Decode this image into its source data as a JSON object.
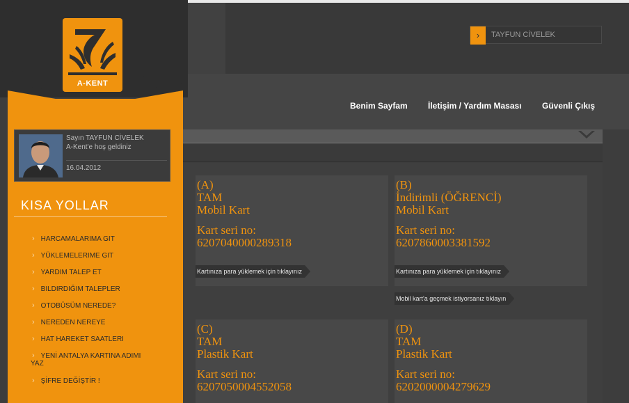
{
  "header": {
    "logo_text": "A-KENT",
    "user_box": {
      "name": "TAYFUN CİVELEK",
      "arrow_icon": "chevron-right-icon"
    }
  },
  "nav": [
    {
      "label": "Benim Sayfam"
    },
    {
      "label": "İletişim / Yardım Masası"
    },
    {
      "label": "Güvenli Çıkış"
    }
  ],
  "profile": {
    "greeting_line1": "Sayın TAYFUN CİVELEK",
    "greeting_line2": "A-Kent'e hoş geldiniz",
    "date": "16.04.2012"
  },
  "shortcuts": {
    "title": "KISA YOLLAR",
    "items": [
      {
        "label": "HARCAMALARIMA GIT"
      },
      {
        "label": "YÜKLEMELERIME GIT"
      },
      {
        "label": "YARDIM TALEP ET"
      },
      {
        "label": "BILDIRDIĞIM TALEPLER"
      },
      {
        "label": "OTOBÜSÜM NEREDE?"
      },
      {
        "label": "NEREDEN NEREYE"
      },
      {
        "label": "HAT HAREKET SAATLERI"
      },
      {
        "label": "YENİ ANTALYA KARTINA ADIMI"
      },
      {
        "label": "YAZ"
      },
      {
        "label": "ŞİFRE DEĞİŞTİR !"
      }
    ]
  },
  "cards": [
    {
      "letter": "(A)",
      "type": "TAM",
      "kind": "Mobil Kart",
      "serial_label": "Kart seri no:",
      "serial": "6207040000289318",
      "links": [
        "Kartınıza para yüklemek için tıklayınız"
      ]
    },
    {
      "letter": "(B)",
      "type": "İndirimli (ÖĞRENCİ)",
      "kind": "Mobil Kart",
      "serial_label": "Kart seri no:",
      "serial": "6207860003381592",
      "links": [
        "Kartınıza para yüklemek için tıklayınız",
        "Mobil kart'a geçmek istiyorsanız tıklayın"
      ]
    },
    {
      "letter": "(C)",
      "type": "TAM",
      "kind": "Plastik Kart",
      "serial_label": "Kart seri no:",
      "serial": "6207050004552058",
      "links": []
    },
    {
      "letter": "(D)",
      "type": "TAM",
      "kind": "Plastik Kart",
      "serial_label": "Kart seri no:",
      "serial": "6202000004279629",
      "links": []
    }
  ],
  "colors": {
    "accent": "#f0930e",
    "background": "#3d3d3d",
    "sidebar_dark": "#2e2e2e",
    "card_bg": "#484848"
  }
}
